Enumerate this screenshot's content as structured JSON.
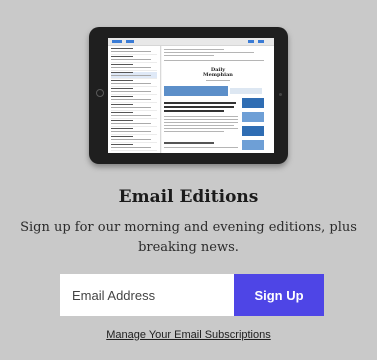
{
  "promo": {
    "title": "Email Editions",
    "description": "Sign up for our morning and evening editions, plus breaking news.",
    "email_placeholder": "Email Address",
    "signup_label": "Sign Up",
    "manage_link": "Manage Your Email Subscriptions"
  },
  "illustration": {
    "masthead": "Daily Memphian"
  },
  "colors": {
    "background": "#c9c9c9",
    "button": "#4e45e6",
    "button_text": "#ffffff",
    "input_bg": "#ffffff"
  }
}
